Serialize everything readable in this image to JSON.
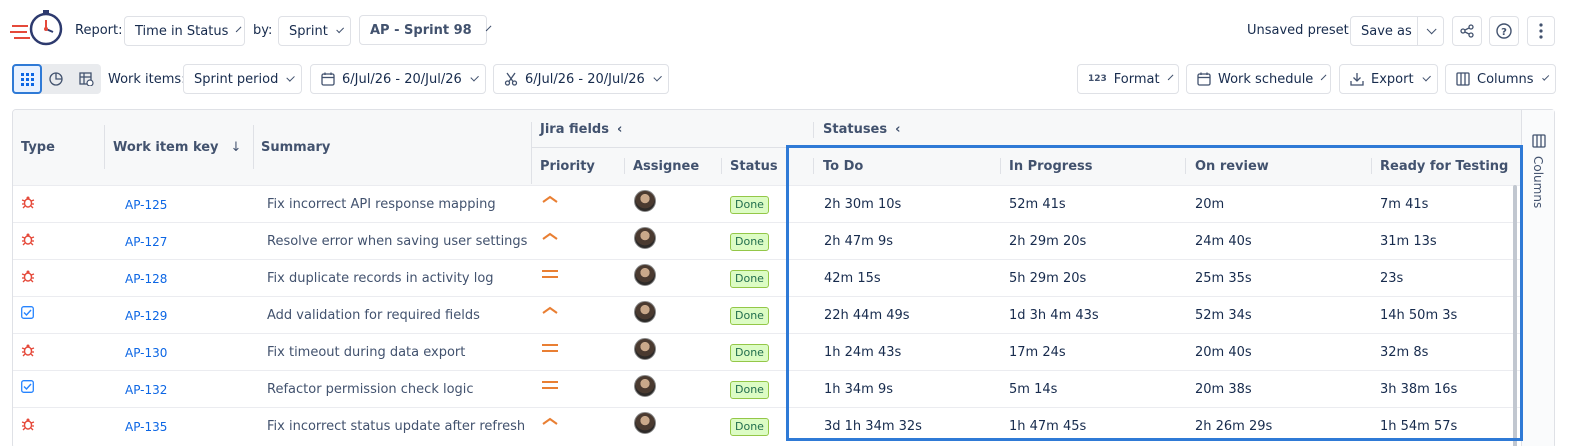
{
  "toolbar1": {
    "report_label": "Report:",
    "report_value": "Time in Status",
    "by_label": "by:",
    "by_value": "Sprint",
    "sprint_value": "AP - Sprint 98",
    "preset_status": "Unsaved preset",
    "save_as": "Save as"
  },
  "toolbar2": {
    "work_items_label": "Work items:",
    "work_items_value": "Sprint period",
    "date_range_1": "6/Jul/26 - 20/Jul/26",
    "date_range_2": "6/Jul/26 - 20/Jul/26",
    "format": "Format",
    "format_icon_text": "123",
    "work_schedule": "Work schedule",
    "export": "Export",
    "columns": "Columns"
  },
  "table": {
    "group_jira_fields": "Jira fields",
    "group_statuses": "Statuses",
    "headers": {
      "type": "Type",
      "key": "Work item key",
      "summary": "Summary",
      "priority": "Priority",
      "assignee": "Assignee",
      "status": "Status",
      "todo": "To Do",
      "in_progress": "In Progress",
      "on_review": "On review",
      "ready_for_testing": "Ready for Testing"
    },
    "rows": [
      {
        "type": "bug",
        "key": "AP-125",
        "summary": "Fix incorrect API response mapping",
        "priority": "high",
        "status": "Done",
        "todo": "2h 30m 10s",
        "in_progress": "52m 41s",
        "on_review": "20m",
        "ready": "7m 41s"
      },
      {
        "type": "bug",
        "key": "AP-127",
        "summary": "Resolve error when saving user settings",
        "priority": "high",
        "status": "Done",
        "todo": "2h 47m 9s",
        "in_progress": "2h 29m 20s",
        "on_review": "24m 40s",
        "ready": "31m 13s"
      },
      {
        "type": "bug",
        "key": "AP-128",
        "summary": "Fix duplicate records in activity log",
        "priority": "medium",
        "status": "Done",
        "todo": "42m 15s",
        "in_progress": "5h 29m 20s",
        "on_review": "25m 35s",
        "ready": "23s"
      },
      {
        "type": "task",
        "key": "AP-129",
        "summary": "Add validation for required fields",
        "priority": "high",
        "status": "Done",
        "todo": "22h 44m 49s",
        "in_progress": "1d 3h 4m 43s",
        "on_review": "52m 34s",
        "ready": "14h 50m 3s"
      },
      {
        "type": "bug",
        "key": "AP-130",
        "summary": "Fix timeout during data export",
        "priority": "medium",
        "status": "Done",
        "todo": "1h 24m 43s",
        "in_progress": "17m 24s",
        "on_review": "20m 40s",
        "ready": "32m 8s"
      },
      {
        "type": "task",
        "key": "AP-132",
        "summary": "Refactor permission check logic",
        "priority": "medium",
        "status": "Done",
        "todo": "1h 34m 9s",
        "in_progress": "5m 14s",
        "on_review": "20m 38s",
        "ready": "3h 38m 16s"
      },
      {
        "type": "bug",
        "key": "AP-135",
        "summary": "Fix incorrect status update after refresh",
        "priority": "high",
        "status": "Done",
        "todo": "3d 1h 34m 32s",
        "in_progress": "1h 47m 45s",
        "on_review": "2h 26m 29s",
        "ready": "1h 54m 57s"
      }
    ]
  },
  "side_rail": {
    "label": "Columns"
  },
  "colors": {
    "accent": "#2f7ad6",
    "bug": "#e5493a",
    "task": "#2684ff",
    "priority": "#e97f33",
    "link": "#0c66e4"
  }
}
